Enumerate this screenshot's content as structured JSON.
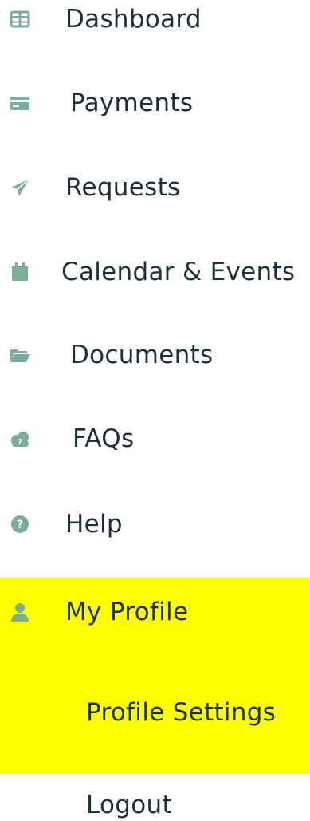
{
  "colors": {
    "icon": "#7aaf95",
    "text": "#1f3138",
    "highlight": "#ffff00",
    "background": "#ffffff"
  },
  "menu": {
    "items": [
      {
        "id": "dashboard",
        "label": "Dashboard",
        "icon": "table-grid-icon"
      },
      {
        "id": "payments",
        "label": "Payments",
        "icon": "credit-card-icon"
      },
      {
        "id": "requests",
        "label": "Requests",
        "icon": "paper-plane-icon"
      },
      {
        "id": "calendar",
        "label": "Calendar & Events",
        "icon": "calendar-icon"
      },
      {
        "id": "documents",
        "label": "Documents",
        "icon": "folder-open-icon"
      },
      {
        "id": "faqs",
        "label": "FAQs",
        "icon": "cloud-question-icon"
      },
      {
        "id": "help",
        "label": "Help",
        "icon": "question-circle-icon"
      },
      {
        "id": "my-profile",
        "label": "My Profile",
        "icon": "user-icon",
        "active": true
      }
    ],
    "subitems": [
      {
        "id": "profile-settings",
        "label": "Profile Settings"
      },
      {
        "id": "logout",
        "label": "Logout"
      }
    ]
  }
}
